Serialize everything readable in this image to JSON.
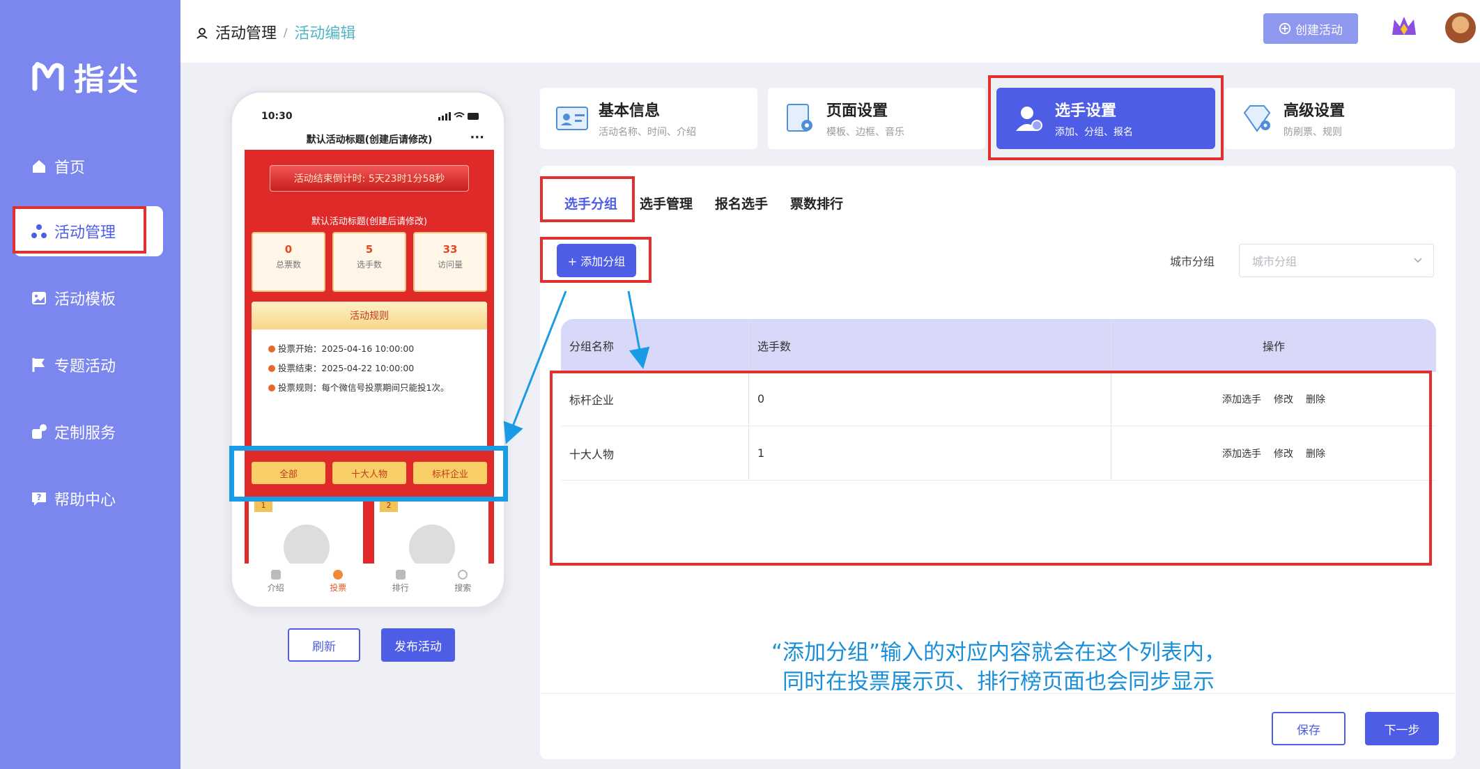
{
  "brand": {
    "name": "指尖"
  },
  "sidebar": {
    "items": [
      {
        "label": "首页",
        "icon": "home-icon"
      },
      {
        "label": "活动管理",
        "icon": "activity-icon"
      },
      {
        "label": "活动模板",
        "icon": "template-icon"
      },
      {
        "label": "专题活动",
        "icon": "flag-icon"
      },
      {
        "label": "定制服务",
        "icon": "service-icon"
      },
      {
        "label": "帮助中心",
        "icon": "help-icon"
      }
    ]
  },
  "header": {
    "crumb_root": "活动管理",
    "crumb_sep": "/",
    "crumb_current": "活动编辑",
    "create_label": "创建活动"
  },
  "phone": {
    "time": "10:30",
    "title": "默认活动标题(创建后请修改)",
    "countdown": "活动结束倒计时: 5天23时1分58秒",
    "subtitle": "默认活动标题(创建后请修改)",
    "stats": [
      {
        "num": "0",
        "label": "总票数"
      },
      {
        "num": "5",
        "label": "选手数"
      },
      {
        "num": "33",
        "label": "访问量"
      }
    ],
    "rules_title": "活动规则",
    "rules": [
      "投票开始：2025-04-16 10:00:00",
      "投票结束：2025-04-22 10:00:00",
      "投票规则：每个微信号投票期间只能投1次。"
    ],
    "filters": [
      "全部",
      "十大人物",
      "标杆企业"
    ],
    "cards": [
      "1",
      "2"
    ],
    "tabbar": [
      "介绍",
      "投票",
      "排行",
      "搜索"
    ]
  },
  "preview": {
    "refresh_label": "刷新",
    "publish_label": "发布活动"
  },
  "steps": [
    {
      "title": "基本信息",
      "sub": "活动名称、时间、介绍"
    },
    {
      "title": "页面设置",
      "sub": "模板、边框、音乐"
    },
    {
      "title": "选手设置",
      "sub": "添加、分组、报名"
    },
    {
      "title": "高级设置",
      "sub": "防刷票、规则"
    }
  ],
  "subtabs": [
    "选手分组",
    "选手管理",
    "报名选手",
    "票数排行"
  ],
  "toolbar": {
    "add_group_label": "+ 添加分组",
    "city_label": "城市分组",
    "city_placeholder": "城市分组"
  },
  "table": {
    "headers": [
      "分组名称",
      "选手数",
      "操作"
    ],
    "rows": [
      {
        "name": "标杆企业",
        "count": "0"
      },
      {
        "name": "十大人物",
        "count": "1"
      }
    ],
    "actions": [
      "添加选手",
      "修改",
      "删除"
    ]
  },
  "annotation": {
    "line1": "“添加分组”输入的对应内容就会在这个列表内，",
    "line2": "同时在投票展示页、排行榜页面也会同步显示"
  },
  "footer": {
    "save_label": "保存",
    "next_label": "下一步"
  },
  "colors": {
    "primary": "#4e5de6",
    "sidebar": "#7b86ee",
    "annotation_red": "#e23030",
    "annotation_blue": "#1a9be6"
  }
}
